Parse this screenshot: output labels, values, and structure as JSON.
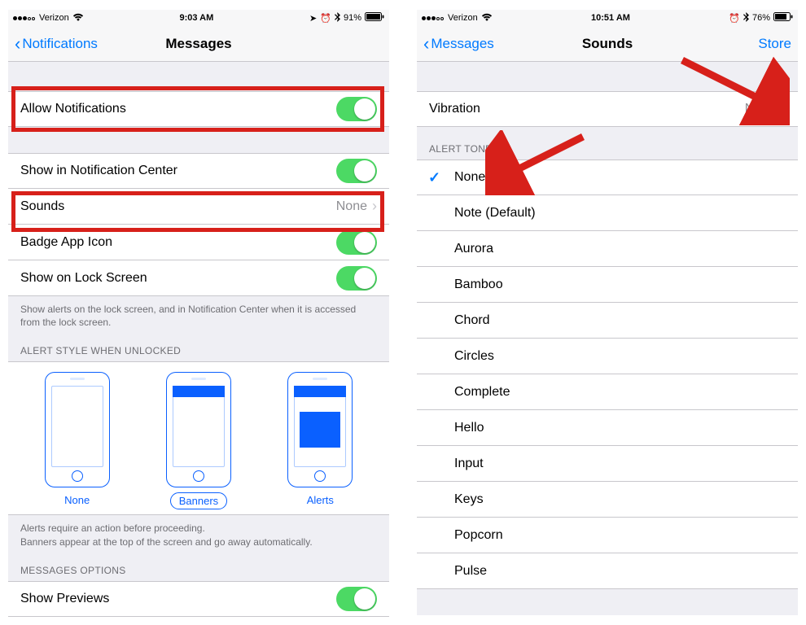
{
  "left": {
    "status": {
      "carrier": "Verizon",
      "time": "9:03 AM",
      "battery_pct": "91%"
    },
    "nav": {
      "back": "Notifications",
      "title": "Messages"
    },
    "rows": {
      "allow_notifications": "Allow Notifications",
      "show_in_nc": "Show in Notification Center",
      "sounds": "Sounds",
      "sounds_value": "None",
      "badge": "Badge App Icon",
      "lock_screen": "Show on Lock Screen",
      "show_previews": "Show Previews"
    },
    "note_lock": "Show alerts on the lock screen, and in Notification Center when it is accessed from the lock screen.",
    "header_alert_style": "ALERT STYLE WHEN UNLOCKED",
    "alert_options": {
      "none": "None",
      "banners": "Banners",
      "alerts": "Alerts"
    },
    "note_alerts": "Alerts require an action before proceeding.\nBanners appear at the top of the screen and go away automatically.",
    "header_messages_options": "MESSAGES OPTIONS"
  },
  "right": {
    "status": {
      "carrier": "Verizon",
      "time": "10:51 AM",
      "battery_pct": "76%"
    },
    "nav": {
      "back": "Messages",
      "title": "Sounds",
      "right": "Store"
    },
    "vibration_label": "Vibration",
    "vibration_value": "None",
    "header_alert_tones": "ALERT TONES",
    "tones": [
      "None",
      "Note (Default)",
      "Aurora",
      "Bamboo",
      "Chord",
      "Circles",
      "Complete",
      "Hello",
      "Input",
      "Keys",
      "Popcorn",
      "Pulse"
    ],
    "selected_tone": "None"
  }
}
